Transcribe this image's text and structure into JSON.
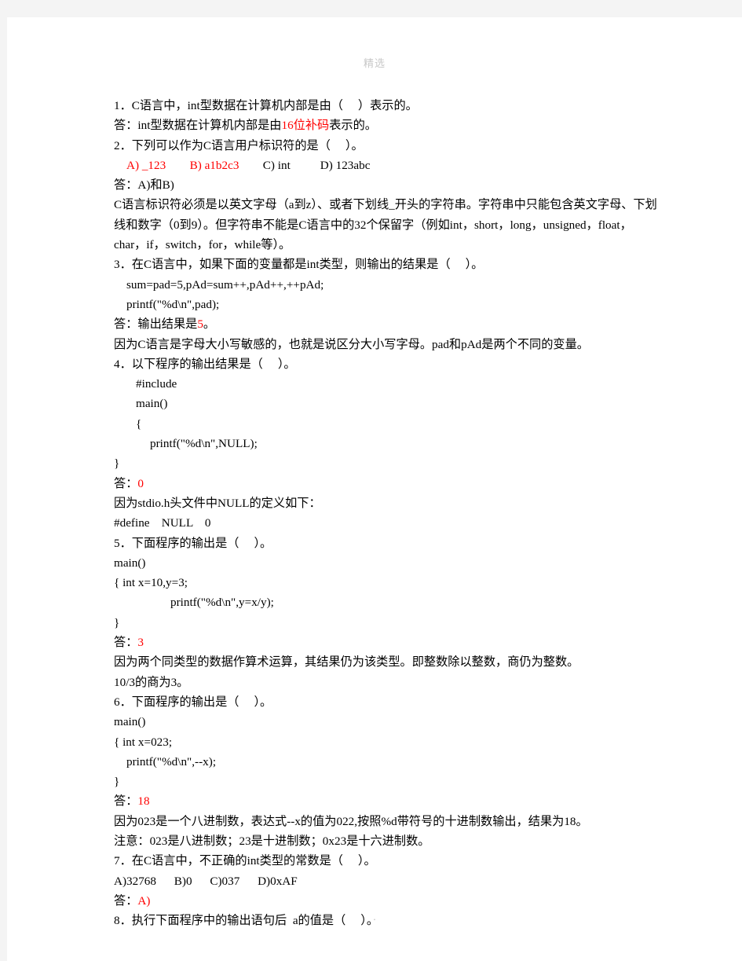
{
  "page": {
    "header_watermark": "精选",
    "footer_mark": "."
  },
  "colors": {
    "page_background": "#ffffff",
    "canvas_background": "#f4f4f4",
    "text": "#000000",
    "answer_highlight": "#ff0000",
    "watermark": "#c8c8c8"
  },
  "lines": [
    {
      "name": "q1-stem",
      "indent": 0,
      "segments": [
        {
          "text": "1．C语言中，int型数据在计算机内部是由（     ）表示的。",
          "color": "black"
        }
      ]
    },
    {
      "name": "q1-answer",
      "indent": 0,
      "segments": [
        {
          "text": "答：int型数据在计算机内部是由",
          "color": "black"
        },
        {
          "text": "16位补码",
          "color": "red"
        },
        {
          "text": "表示的。",
          "color": "black"
        }
      ]
    },
    {
      "name": "q2-stem",
      "indent": 0,
      "segments": [
        {
          "text": "2．下列可以作为C语言用户标识符的是（     ）。",
          "color": "black"
        }
      ]
    },
    {
      "name": "q2-options",
      "indent": 1,
      "segments": [
        {
          "text": "A) _123",
          "color": "red"
        },
        {
          "text": "        ",
          "color": "black"
        },
        {
          "text": "B) a1b2c3",
          "color": "red"
        },
        {
          "text": "        C) int          D) 123abc",
          "color": "black"
        }
      ]
    },
    {
      "name": "q2-answer",
      "indent": 0,
      "segments": [
        {
          "text": "答：A)和B)",
          "color": "black"
        }
      ]
    },
    {
      "name": "q2-explanation",
      "indent": 0,
      "segments": [
        {
          "text": "C语言标识符必须是以英文字母（a到z）、或者下划线_开头的字符串。字符串中只能包含英文字母、下划线和数字（0到9）。但字符串不能是C语言中的32个保留字（例如int，short，long，unsigned，float，char，if，switch，for，while等）。",
          "color": "black"
        }
      ]
    },
    {
      "name": "q3-stem",
      "indent": 0,
      "segments": [
        {
          "text": "3．在C语言中，如果下面的变量都是int类型，则输出的结果是（     ）。",
          "color": "black"
        }
      ]
    },
    {
      "name": "q3-code-1",
      "indent": 1,
      "segments": [
        {
          "text": "sum=pad=5,pAd=sum++,pAd++,++pAd;",
          "color": "black"
        }
      ]
    },
    {
      "name": "q3-code-2",
      "indent": 1,
      "segments": [
        {
          "text": "printf(\"%d\\n\",pad);",
          "color": "black"
        }
      ]
    },
    {
      "name": "q3-answer",
      "indent": 0,
      "segments": [
        {
          "text": "答：输出结果是",
          "color": "black"
        },
        {
          "text": "5",
          "color": "red"
        },
        {
          "text": "。",
          "color": "black"
        }
      ]
    },
    {
      "name": "q3-explanation",
      "indent": 0,
      "segments": [
        {
          "text": "因为C语言是字母大小写敏感的，也就是说区分大小写字母。pad和pAd是两个不同的变量。",
          "color": "black"
        }
      ]
    },
    {
      "name": "q4-stem",
      "indent": 0,
      "segments": [
        {
          "text": "4．以下程序的输出结果是（     ）。",
          "color": "black"
        }
      ]
    },
    {
      "name": "q4-code-1",
      "indent": 2,
      "segments": [
        {
          "text": "#include",
          "color": "black"
        }
      ]
    },
    {
      "name": "q4-code-2",
      "indent": 2,
      "segments": [
        {
          "text": "main()",
          "color": "black"
        }
      ]
    },
    {
      "name": "q4-code-3",
      "indent": 2,
      "segments": [
        {
          "text": "{",
          "color": "black"
        }
      ]
    },
    {
      "name": "q4-code-4",
      "indent": 3,
      "segments": [
        {
          "text": "printf(\"%d\\n\",NULL);",
          "color": "black"
        }
      ]
    },
    {
      "name": "q4-code-5",
      "indent": 0,
      "segments": [
        {
          "text": "}",
          "color": "black"
        }
      ]
    },
    {
      "name": "q4-answer",
      "indent": 0,
      "segments": [
        {
          "text": "答：",
          "color": "black"
        },
        {
          "text": "0",
          "color": "red"
        }
      ]
    },
    {
      "name": "q4-explanation-1",
      "indent": 0,
      "segments": [
        {
          "text": "因为stdio.h头文件中NULL的定义如下：",
          "color": "black"
        }
      ]
    },
    {
      "name": "q4-explanation-2",
      "indent": 0,
      "segments": [
        {
          "text": "#define    NULL    0",
          "color": "black"
        }
      ]
    },
    {
      "name": "q5-stem",
      "indent": 0,
      "segments": [
        {
          "text": "5．下面程序的输出是（     ）。",
          "color": "black"
        }
      ]
    },
    {
      "name": "q5-code-1",
      "indent": 0,
      "segments": [
        {
          "text": "main()",
          "color": "black"
        }
      ]
    },
    {
      "name": "q5-code-2",
      "indent": 0,
      "segments": [
        {
          "text": "{ int x=10,y=3;",
          "color": "black"
        }
      ]
    },
    {
      "name": "q5-code-3",
      "indent": 4,
      "segments": [
        {
          "text": "printf(\"%d\\n\",y=x/y);",
          "color": "black"
        }
      ]
    },
    {
      "name": "q5-code-4",
      "indent": 0,
      "segments": [
        {
          "text": "}",
          "color": "black"
        }
      ]
    },
    {
      "name": "q5-answer",
      "indent": 0,
      "segments": [
        {
          "text": "答：",
          "color": "black"
        },
        {
          "text": "3",
          "color": "red"
        }
      ]
    },
    {
      "name": "q5-explanation-1",
      "indent": 0,
      "segments": [
        {
          "text": "因为两个同类型的数据作算术运算，其结果仍为该类型。即整数除以整数，商仍为整数。",
          "color": "black"
        }
      ]
    },
    {
      "name": "q5-explanation-2",
      "indent": 0,
      "segments": [
        {
          "text": "10/3的商为3。",
          "color": "black"
        }
      ]
    },
    {
      "name": "q6-stem",
      "indent": 0,
      "segments": [
        {
          "text": "6．下面程序的输出是（     ）。",
          "color": "black"
        }
      ]
    },
    {
      "name": "q6-code-1",
      "indent": 0,
      "segments": [
        {
          "text": "main()",
          "color": "black"
        }
      ]
    },
    {
      "name": "q6-code-2",
      "indent": 0,
      "segments": [
        {
          "text": "{ int x=023;",
          "color": "black"
        }
      ]
    },
    {
      "name": "q6-code-3",
      "indent": 1,
      "segments": [
        {
          "text": "printf(\"%d\\n\",--x);",
          "color": "black"
        }
      ]
    },
    {
      "name": "q6-code-4",
      "indent": 0,
      "segments": [
        {
          "text": "}",
          "color": "black"
        }
      ]
    },
    {
      "name": "q6-answer",
      "indent": 0,
      "segments": [
        {
          "text": "答：",
          "color": "black"
        },
        {
          "text": "18",
          "color": "red"
        }
      ]
    },
    {
      "name": "q6-explanation-1",
      "indent": 0,
      "segments": [
        {
          "text": "因为023是一个八进制数，表达式--x的值为022,按照%d带符号的十进制数输出，结果为18。",
          "color": "black"
        }
      ]
    },
    {
      "name": "q6-explanation-2",
      "indent": 0,
      "segments": [
        {
          "text": "注意：023是八进制数；23是十进制数；0x23是十六进制数。",
          "color": "black"
        }
      ]
    },
    {
      "name": "q7-stem",
      "indent": 0,
      "segments": [
        {
          "text": "7．在C语言中，不正确的int类型的常数是（     ）。",
          "color": "black"
        }
      ]
    },
    {
      "name": "q7-options",
      "indent": 0,
      "segments": [
        {
          "text": "A)32768      B)0      C)037      D)0xAF",
          "color": "black"
        }
      ]
    },
    {
      "name": "q7-answer",
      "indent": 0,
      "segments": [
        {
          "text": "答：",
          "color": "black"
        },
        {
          "text": "A)",
          "color": "red"
        }
      ]
    },
    {
      "name": "q8-stem",
      "indent": 0,
      "segments": [
        {
          "text": "8．执行下面程序中的输出语句后  a的值是（     ）。",
          "color": "black"
        }
      ]
    }
  ]
}
